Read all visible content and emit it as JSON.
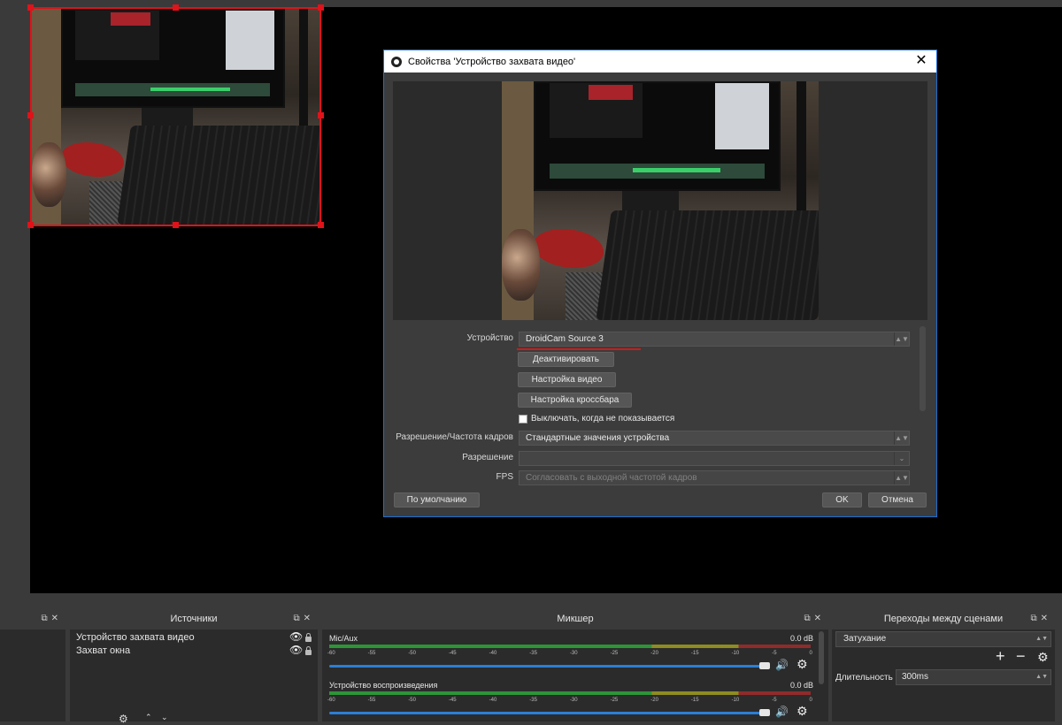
{
  "dialog": {
    "title": "Свойства 'Устройство захвата видео'",
    "close_label": "✕",
    "device_label": "Устройство",
    "device_value": "DroidCam Source 3",
    "deactivate_label": "Деактивировать",
    "video_settings_label": "Настройка видео",
    "crossbar_settings_label": "Настройка кроссбара",
    "deactivate_when_hidden_label": "Выключать, когда не показывается",
    "deactivate_when_hidden_checked": false,
    "resolution_fps_label": "Разрешение/Частота кадров",
    "resolution_fps_value": "Стандартные значения устройства",
    "resolution_label": "Разрешение",
    "resolution_value": "",
    "fps_label": "FPS",
    "fps_value": "Согласовать с выходной частотой кадров",
    "defaults_label": "По умолчанию",
    "ok_label": "OK",
    "cancel_label": "Отмена"
  },
  "sources": {
    "title": "Источники",
    "items": [
      {
        "label": "Устройство захвата видео"
      },
      {
        "label": "Захват окна"
      }
    ]
  },
  "mixer": {
    "title": "Микшер",
    "scale": [
      "-60",
      "-55",
      "-50",
      "-45",
      "-40",
      "-35",
      "-30",
      "-25",
      "-20",
      "-15",
      "-10",
      "-5",
      "0"
    ],
    "channels": [
      {
        "name": "Mic/Aux",
        "db": "0.0 dB"
      },
      {
        "name": "Устройство воспроизведения",
        "db": "0.0 dB"
      }
    ]
  },
  "transitions": {
    "title": "Переходы между сценами",
    "selected": "Затухание",
    "duration_label": "Длительность",
    "duration_value": "300ms",
    "add_label": "+",
    "remove_label": "−"
  },
  "colors": {
    "accent": "#1b6fd1",
    "selection": "#e0121a",
    "meter_green": "#2fae3b",
    "meter_yellow": "#a6a51f",
    "meter_red": "#aa2b2b"
  }
}
